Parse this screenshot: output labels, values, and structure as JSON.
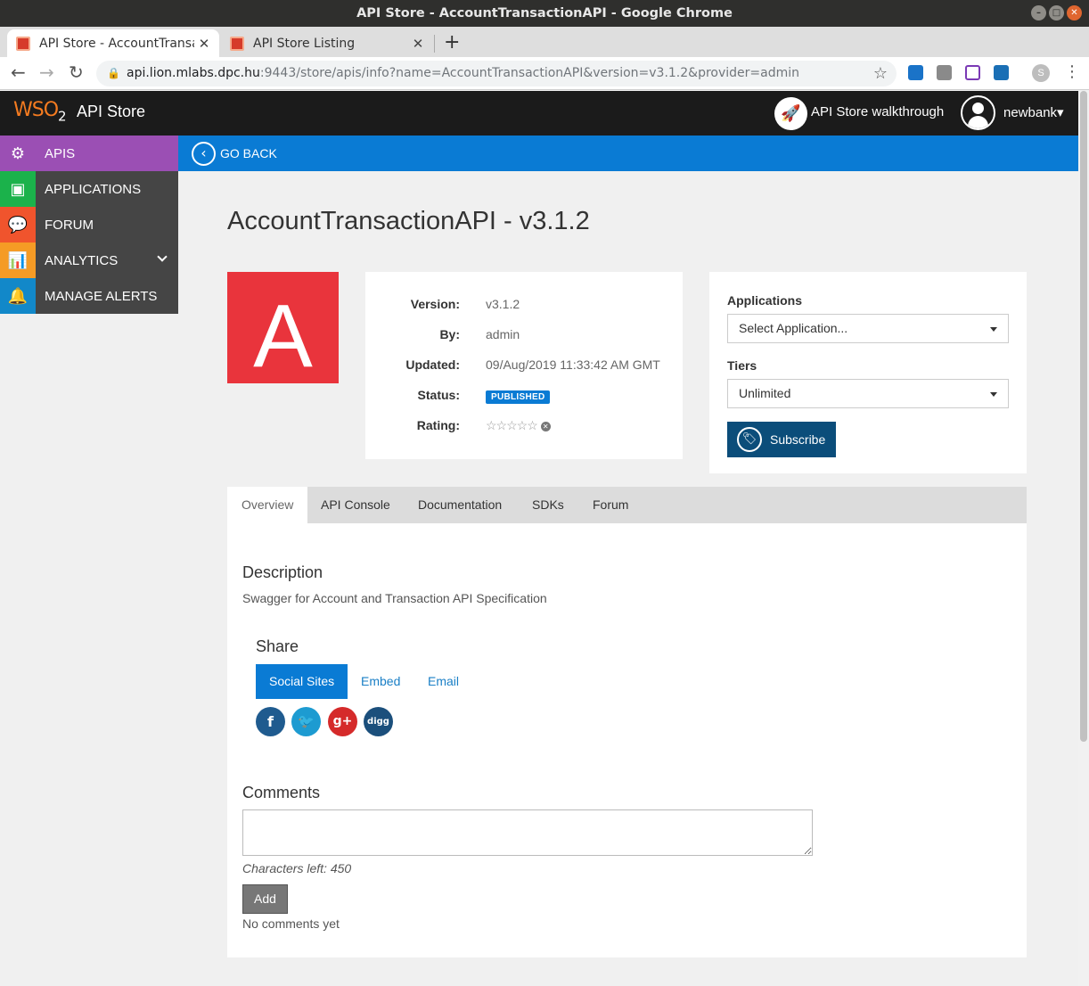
{
  "window": {
    "title": "API Store - AccountTransactionAPI - Google Chrome"
  },
  "browser": {
    "tabs": [
      {
        "label": "API Store - AccountTransa",
        "close": "✕"
      },
      {
        "label": "API Store Listing",
        "close": "✕"
      }
    ],
    "new_tab": "+",
    "url_host": "api.lion.mlabs.dpc.hu",
    "url_rest": ":9443/store/apis/info?name=AccountTransactionAPI&version=v3.1.2&provider=admin",
    "profile_initial": "S"
  },
  "header": {
    "logo_text": "WSO",
    "logo_sub": "2",
    "app_name": "API Store",
    "walkthrough_label": "API Store walkthrough",
    "user_name": "newbank▾"
  },
  "sidebar": {
    "items": [
      {
        "label": "APIS",
        "icon": "api-gear-icon",
        "color": "#9b4fb4"
      },
      {
        "label": "APPLICATIONS",
        "icon": "applications-icon",
        "color": "#1bb24b"
      },
      {
        "label": "FORUM",
        "icon": "forum-icon",
        "color": "#f0542d"
      },
      {
        "label": "ANALYTICS",
        "icon": "analytics-icon",
        "color": "#f59b25"
      },
      {
        "label": "MANAGE ALERTS",
        "icon": "bell-icon",
        "color": "#1288c9"
      }
    ]
  },
  "go_back_label": "GO BACK",
  "api": {
    "title": "AccountTransactionAPI - v3.1.2",
    "thumbnail_letter": "A",
    "version_label": "Version:",
    "version": "v3.1.2",
    "by_label": "By:",
    "by": "admin",
    "updated_label": "Updated:",
    "updated": "09/Aug/2019 11:33:42 AM GMT",
    "status_label": "Status:",
    "status": "PUBLISHED",
    "rating_label": "Rating:",
    "rating_stars": "☆☆☆☆☆",
    "rating_value": 0
  },
  "subscribe": {
    "applications_label": "Applications",
    "application_selected": "Select Application...",
    "tiers_label": "Tiers",
    "tier_selected": "Unlimited",
    "button_label": "Subscribe"
  },
  "tabs": [
    "Overview",
    "API Console",
    "Documentation",
    "SDKs",
    "Forum"
  ],
  "overview": {
    "description_heading": "Description",
    "description": "Swagger for Account and Transaction API Specification",
    "share_heading": "Share",
    "share_tabs": [
      "Social Sites",
      "Embed",
      "Email"
    ],
    "social": [
      {
        "name": "facebook",
        "glyph": "f",
        "color": "#1f5b8f"
      },
      {
        "name": "twitter",
        "glyph": "t",
        "color": "#1d9bd1"
      },
      {
        "name": "google-plus",
        "glyph": "g+",
        "color": "#d52a2a"
      },
      {
        "name": "digg",
        "glyph": "digg",
        "color": "#1b4f7c"
      }
    ],
    "comments_heading": "Comments",
    "chars_left": "Characters left: 450",
    "add_label": "Add",
    "no_comments": "No comments yet"
  }
}
